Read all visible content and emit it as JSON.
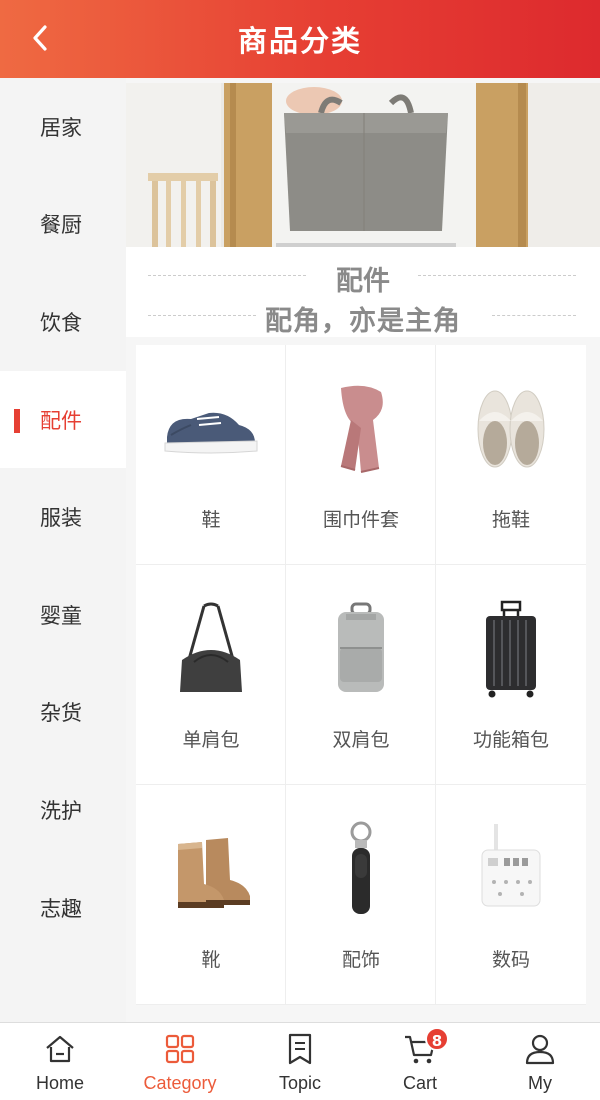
{
  "header": {
    "title": "商品分类",
    "back_icon": "chevron-left-icon"
  },
  "sidebar": {
    "items": [
      {
        "label": "居家"
      },
      {
        "label": "餐厨"
      },
      {
        "label": "饮食"
      },
      {
        "label": "配件",
        "active": true
      },
      {
        "label": "服装"
      },
      {
        "label": "婴童"
      },
      {
        "label": "杂货"
      },
      {
        "label": "洗护"
      },
      {
        "label": "志趣"
      }
    ]
  },
  "section": {
    "title": "配件",
    "subtitle": "配角，亦是主角"
  },
  "products": [
    {
      "label": "鞋",
      "icon": "sneaker-icon"
    },
    {
      "label": "围巾件套",
      "icon": "scarf-icon"
    },
    {
      "label": "拖鞋",
      "icon": "slippers-icon"
    },
    {
      "label": "单肩包",
      "icon": "tote-bag-icon"
    },
    {
      "label": "双肩包",
      "icon": "backpack-icon"
    },
    {
      "label": "功能箱包",
      "icon": "suitcase-icon"
    },
    {
      "label": "靴",
      "icon": "boots-icon"
    },
    {
      "label": "配饰",
      "icon": "keychain-icon"
    },
    {
      "label": "数码",
      "icon": "power-strip-icon"
    }
  ],
  "tabbar": {
    "tabs": [
      {
        "label": "Home",
        "icon": "home-icon"
      },
      {
        "label": "Category",
        "icon": "category-grid-icon",
        "active": true
      },
      {
        "label": "Topic",
        "icon": "bookmark-icon"
      },
      {
        "label": "Cart",
        "icon": "cart-icon"
      },
      {
        "label": "My",
        "icon": "user-icon"
      }
    ],
    "cart_badge": "8"
  },
  "colors": {
    "accent": "#e63f33",
    "header_start": "#ef6a42",
    "header_end": "#dd2a2e"
  }
}
